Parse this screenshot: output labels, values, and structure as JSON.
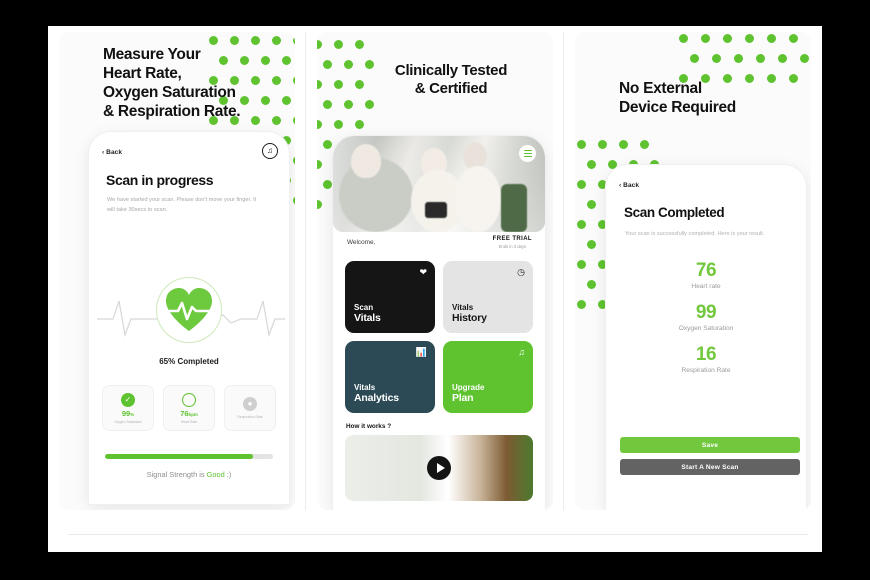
{
  "theme": {
    "green": "#5ec32f",
    "result_green": "#72c83c",
    "dark": "#151515",
    "navy": "#2b4a55",
    "grey_btn": "#636363"
  },
  "panels": [
    {
      "headline": "Measure Your\nHeart Rate,\nOxygen Saturation\n& Respiration Rate.",
      "phone": {
        "back_label": "‹ Back",
        "music_icon": "music-note-icon",
        "title": "Scan in progress",
        "subtitle": "We have started your scan. Please don't move your finger. It will take 30secs to scan.",
        "progress_label": "65% Completed",
        "progress_percent": 65,
        "metrics": [
          {
            "icon": "check-circle-icon",
            "value": "99",
            "unit": "%",
            "label": "Oxygen Saturation"
          },
          {
            "icon": "heart-rate-ring-icon",
            "value": "76",
            "unit": "bpm",
            "label": "Heart Rate"
          },
          {
            "icon": "pending-circle-icon",
            "value": "",
            "unit": "",
            "label": "Respiration Rate"
          }
        ],
        "signal_prefix": "Signal Strength is ",
        "signal_value": "Good",
        "signal_suffix": " :)",
        "signal_percent": 88
      }
    },
    {
      "headline": "Clinically Tested\n& Certified",
      "phone": {
        "menu_icon": "hamburger-menu-icon",
        "welcome": "Welcome,",
        "trial_title": "FREE TRIAL",
        "trial_sub": "Ends in 3 days",
        "tiles": [
          {
            "line1": "Scan",
            "line2": "Vitals",
            "icon": "heart-badge-icon",
            "style": "black"
          },
          {
            "line1": "Vitals",
            "line2": "History",
            "icon": "history-clock-icon",
            "style": "light"
          },
          {
            "line1": "Vitals",
            "line2": "Analytics",
            "icon": "chart-bars-icon",
            "style": "navy"
          },
          {
            "line1": "Upgrade",
            "line2": "Plan",
            "icon": "music-note-icon",
            "style": "green"
          }
        ],
        "how_it_works": "How it works ?",
        "play_icon": "play-button-icon"
      }
    },
    {
      "headline": "No External\nDevice Required",
      "phone": {
        "back_label": "‹ Back",
        "title": "Scan Completed",
        "subtitle": "Your scan is successfully completed. Here is your result.",
        "results": [
          {
            "value": "76",
            "label": "Heart rate"
          },
          {
            "value": "99",
            "label": "Oxygen Saturation"
          },
          {
            "value": "16",
            "label": "Respiration Rate"
          }
        ],
        "save_label": "Save",
        "new_scan_label": "Start A New Scan"
      }
    }
  ]
}
